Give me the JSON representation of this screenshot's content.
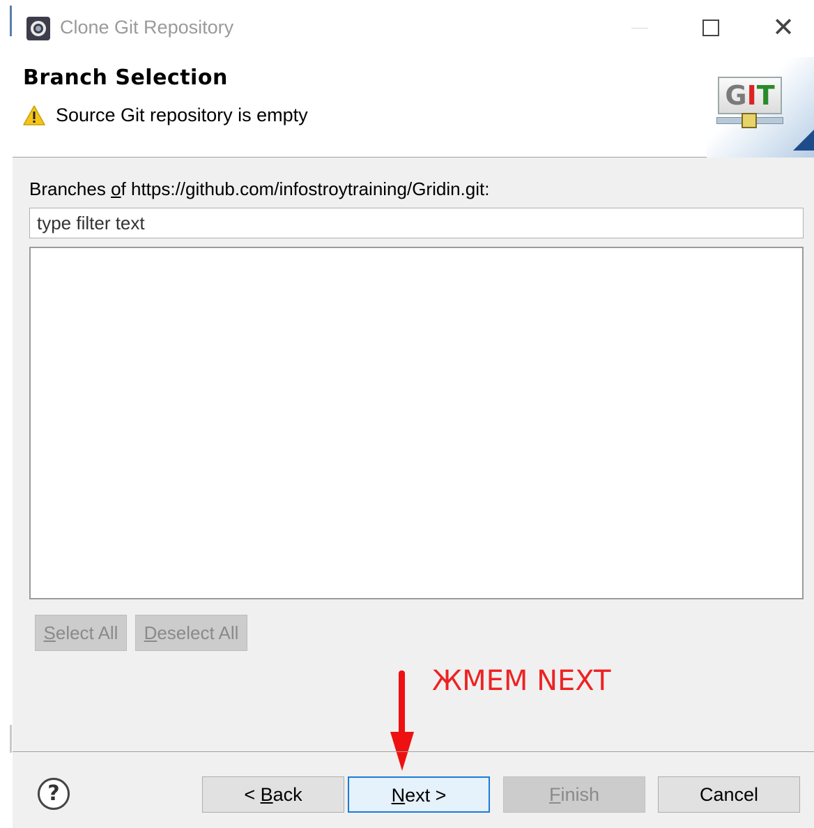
{
  "window": {
    "title": "Clone Git Repository"
  },
  "header": {
    "page_title": "Branch Selection",
    "message": "Source Git repository is empty",
    "logo_text": {
      "g": "G",
      "i": "I",
      "t": "T"
    }
  },
  "branches": {
    "label_before": "Branches ",
    "label_mnemonic": "o",
    "label_after": "f https://github.com/infostroytraining/Gridin.git:",
    "filter_placeholder": "type filter text",
    "items": []
  },
  "list_buttons": {
    "select_all": {
      "mnemonic": "S",
      "rest": "elect All"
    },
    "deselect_all": {
      "mnemonic": "D",
      "rest": "eselect All"
    }
  },
  "annotation": {
    "text": "ЖМЕМ NEXT",
    "color": "#ee2222"
  },
  "footer": {
    "help": "?",
    "back": {
      "prefix": "< ",
      "mnemonic": "B",
      "rest": "ack"
    },
    "next": {
      "mnemonic": "N",
      "rest": "ext >"
    },
    "finish": {
      "mnemonic": "F",
      "rest": "inish"
    },
    "cancel": "Cancel"
  },
  "colors": {
    "accent_focus": "#1a7bd6",
    "warning": "#f5c518"
  }
}
